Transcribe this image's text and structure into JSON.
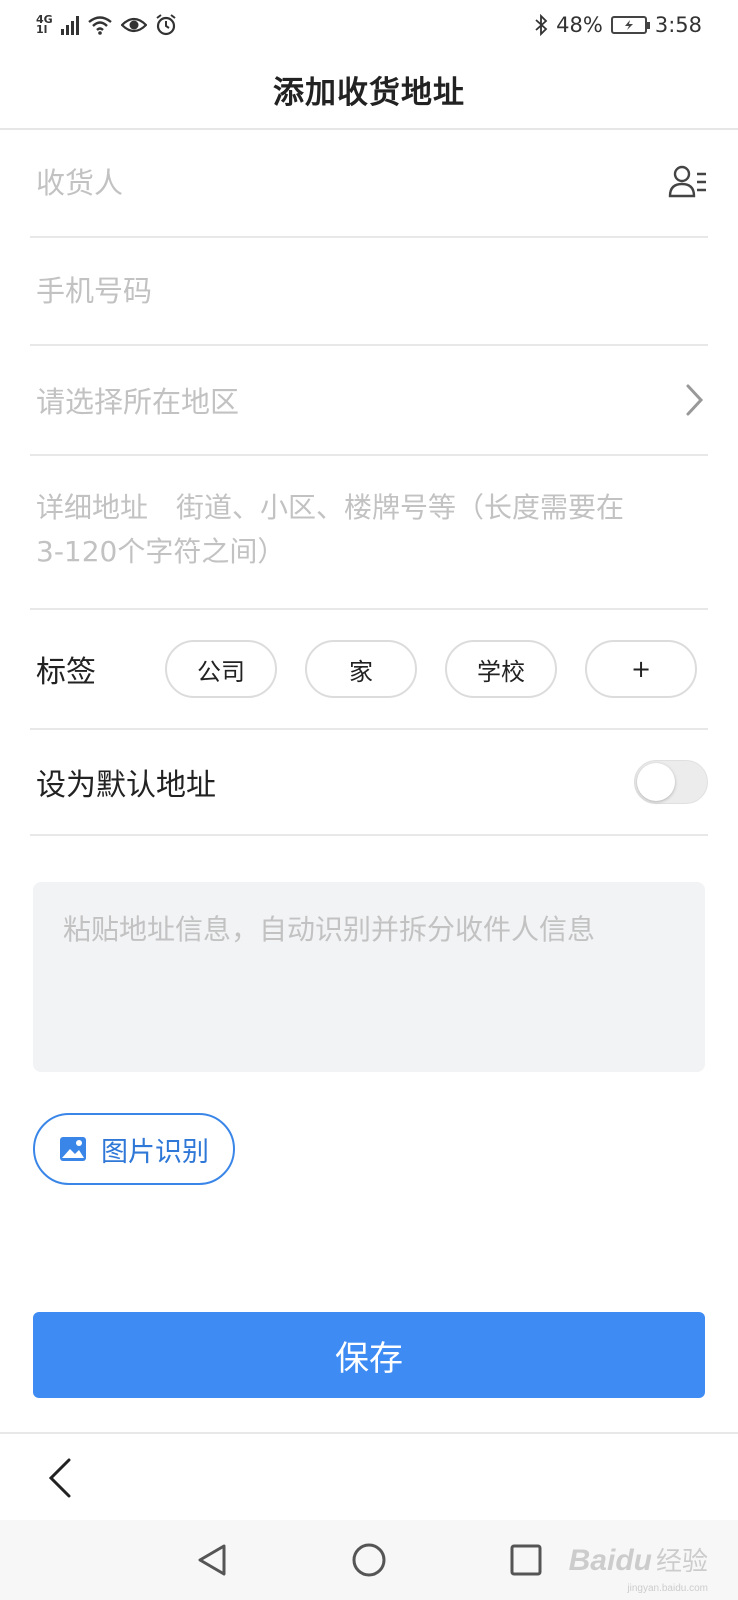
{
  "status_bar": {
    "network": "4G",
    "network_sub": "1l",
    "battery_percent": "48%",
    "time": "3:58",
    "icons": [
      "signal-icon",
      "wifi-icon",
      "eye-icon",
      "alarm-icon",
      "bluetooth-icon",
      "battery-charging-icon"
    ]
  },
  "header": {
    "title": "添加收货地址"
  },
  "form": {
    "consignee_placeholder": "收货人",
    "consignee_value": "",
    "phone_placeholder": "手机号码",
    "phone_value": "",
    "region_placeholder": "请选择所在地区",
    "detail_placeholder": "详细地址　街道、小区、楼牌号等（长度需要在3-120个字符之间）",
    "detail_value": "",
    "tag_label": "标签",
    "tags": [
      "公司",
      "家",
      "学校",
      "+"
    ],
    "default_label": "设为默认地址",
    "default_enabled": false
  },
  "paste": {
    "placeholder": "粘贴地址信息，自动识别并拆分收件人信息",
    "value": ""
  },
  "image_recognition": {
    "label": "图片识别"
  },
  "save": {
    "label": "保存"
  },
  "colors": {
    "primary": "#3e8bf4",
    "accent_text": "#2f78d8",
    "placeholder": "#c2c2c2",
    "divider": "#e8e8e8",
    "paste_bg": "#f2f3f5"
  },
  "watermark": {
    "text": "Baidu",
    "cn": "经验",
    "sub": "jingyan.baidu.com"
  }
}
